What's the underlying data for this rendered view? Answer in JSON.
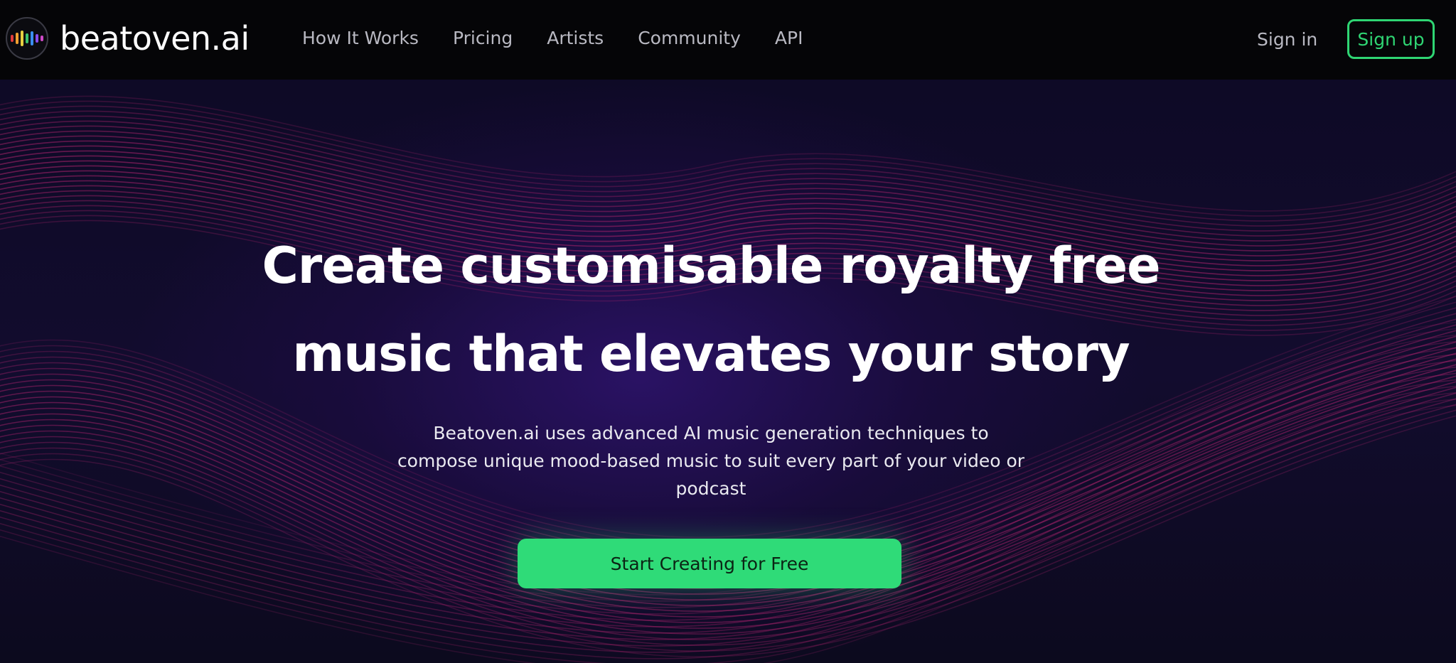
{
  "brand": {
    "name": "beatoven.ai",
    "bar_colors": [
      "#e23b3b",
      "#f0a030",
      "#e8d040",
      "#3ec46d",
      "#3a8ef0",
      "#8a4ef0",
      "#d04ac8"
    ]
  },
  "nav": {
    "links": [
      "How It Works",
      "Pricing",
      "Artists",
      "Community",
      "API"
    ],
    "signin": "Sign in",
    "signup": "Sign up"
  },
  "hero": {
    "headline_line1": "Create customisable royalty free",
    "headline_line2": "music that elevates your story",
    "sub_line1": "Beatoven.ai uses advanced AI music generation techniques to",
    "sub_line2": "compose unique mood-based music to suit every part of your video or",
    "sub_line3": "podcast",
    "cta": "Start Creating for Free"
  },
  "colors": {
    "accent": "#2fd573",
    "cta": "#2fdb78",
    "wave": "#b0246e",
    "background": "#120c2e"
  }
}
